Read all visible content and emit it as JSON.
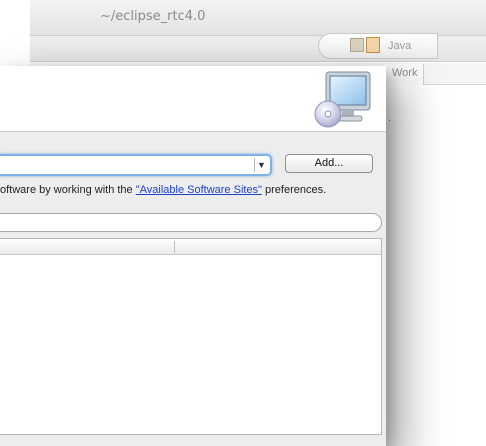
{
  "background_window": {
    "title": "~/eclipse_rtc4.0",
    "perspective_label": "Java",
    "tab_label": "Work",
    "trailing_text": "."
  },
  "dialog": {
    "work_with": {
      "value": ""
    },
    "add_button_label": "Add...",
    "sites_text": {
      "prefix": "oftware by working with the ",
      "link": "\"Available Software Sites\"",
      "suffix": " preferences."
    },
    "filter": {
      "value": ""
    },
    "table": {
      "columns": [
        "",
        ""
      ]
    }
  },
  "colors": {
    "link": "#1d43c8",
    "focus_ring": "#7fb0e8",
    "dialog_body": "#ededed"
  },
  "icons": {
    "banner": "computer-install-cd-icon",
    "combo_arrow": "chevron-down-icon"
  }
}
